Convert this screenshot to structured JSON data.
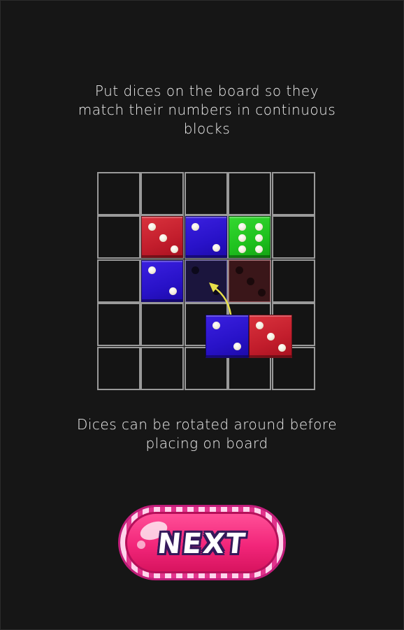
{
  "instructions": {
    "top": "Put dices on the board so they match their numbers in continuous blocks",
    "bottom": "Dices can be rotated around before placing on board"
  },
  "board": {
    "rows": 5,
    "cols": 5,
    "placed_dice": [
      {
        "row": 1,
        "col": 1,
        "color": "red",
        "value": 3
      },
      {
        "row": 1,
        "col": 2,
        "color": "blue",
        "value": 2
      },
      {
        "row": 1,
        "col": 3,
        "color": "green",
        "value": 6
      },
      {
        "row": 2,
        "col": 1,
        "color": "blue",
        "value": 2
      }
    ],
    "ghost_dice": [
      {
        "row": 2,
        "col": 2,
        "color": "ghost-blue",
        "value": 2
      },
      {
        "row": 2,
        "col": 3,
        "color": "ghost-red",
        "value": 3
      }
    ]
  },
  "dragged_piece": [
    {
      "color": "blue",
      "value": 2
    },
    {
      "color": "red",
      "value": 3
    }
  ],
  "hint_arrow": {
    "color": "#e8e04a",
    "icon": "curved-arrow-icon"
  },
  "next_button": {
    "label": "NEXT"
  },
  "colors": {
    "background": "#161616",
    "grid": "#9a9a9a",
    "red": "#c21d2c",
    "blue": "#2812c8",
    "green": "#1fc11e",
    "button": "#f2267a"
  }
}
